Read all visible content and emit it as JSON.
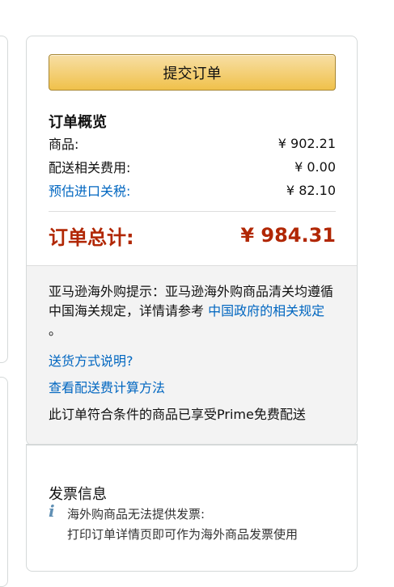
{
  "order": {
    "submit_label": "提交订单",
    "summary_title": "订单概览",
    "lines": [
      {
        "label": "商品:",
        "value": "¥ 902.21"
      },
      {
        "label": "配送相关费用:",
        "value": "¥ 0.00"
      },
      {
        "label": "预估进口关税:",
        "value": "¥ 82.10"
      }
    ],
    "total_label": "订单总计:",
    "total_value": "¥ 984.31"
  },
  "notice": {
    "text": "亚马逊海外购提示：亚马逊海外购商品清关均遵循中国海关规定，详情请参考 ",
    "link": "中国政府的相关规定",
    "tail": " 。"
  },
  "links": {
    "shipping_method": "送货方式说明?",
    "shipping_fee": "查看配送费计算方法"
  },
  "prime_note": "此订单符合条件的商品已享受Prime免费配送",
  "invoice": {
    "title": "发票信息",
    "icon": "info-icon",
    "line1": "海外购商品无法提供发票:",
    "line2": "打印订单详情页即可作为海外商品发票使用"
  },
  "colors": {
    "accent_link": "#0066c0",
    "total_red": "#b12704",
    "button_yellow": "#f0c14b"
  }
}
